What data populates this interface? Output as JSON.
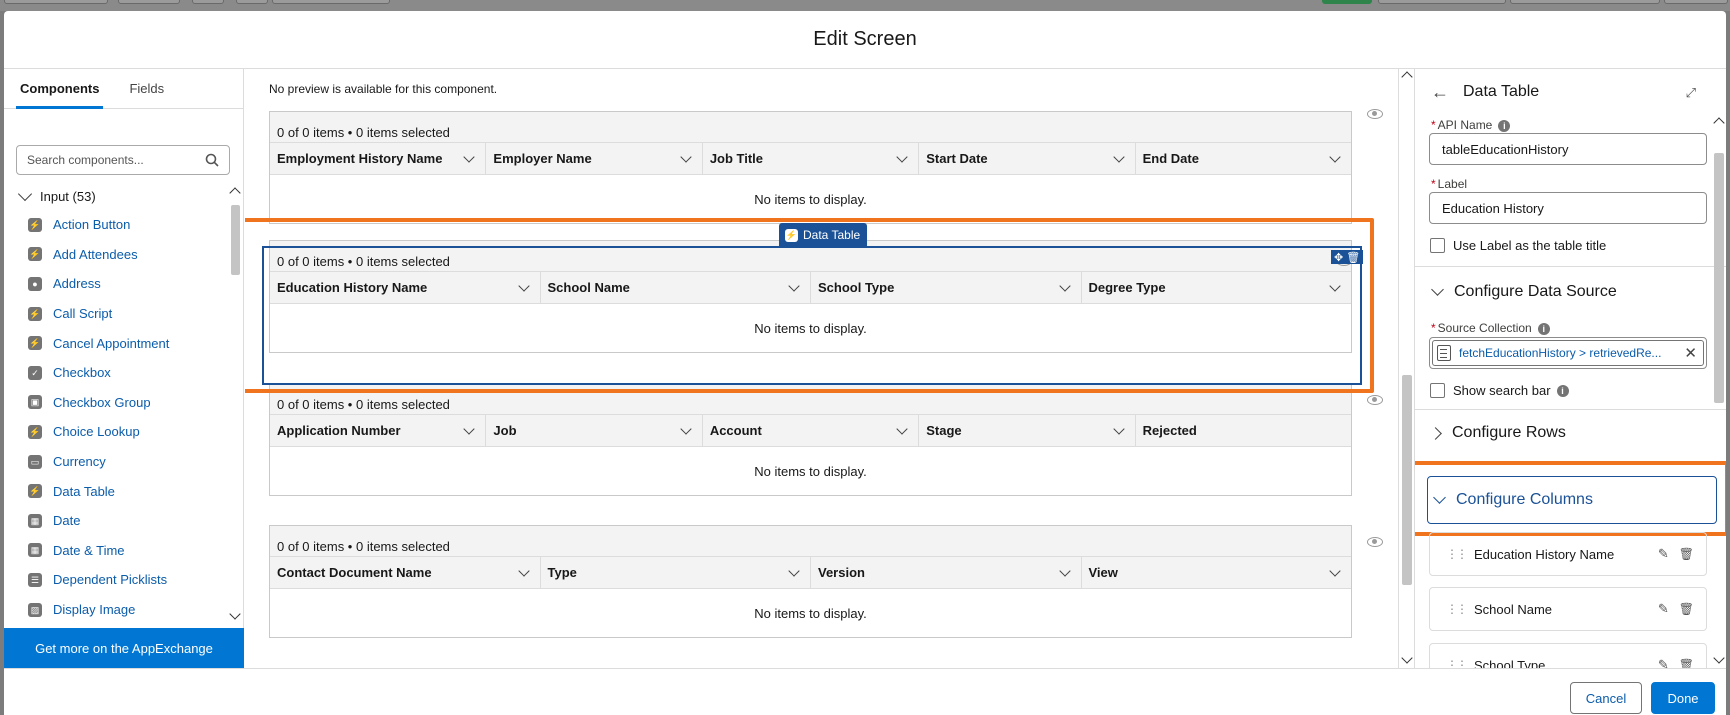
{
  "modal": {
    "title": "Edit Screen"
  },
  "left_panel": {
    "tabs": [
      {
        "label": "Components",
        "active": true
      },
      {
        "label": "Fields",
        "active": false
      }
    ],
    "search_placeholder": "Search components...",
    "group_label": "Input (53)",
    "components": [
      {
        "label": "Action Button",
        "icon": "lightning-icon"
      },
      {
        "label": "Add Attendees",
        "icon": "lightning-icon"
      },
      {
        "label": "Address",
        "icon": "location-icon"
      },
      {
        "label": "Call Script",
        "icon": "lightning-icon"
      },
      {
        "label": "Cancel Appointment",
        "icon": "lightning-icon"
      },
      {
        "label": "Checkbox",
        "icon": "checkbox-icon"
      },
      {
        "label": "Checkbox Group",
        "icon": "checkbox-group-icon"
      },
      {
        "label": "Choice Lookup",
        "icon": "lightning-icon"
      },
      {
        "label": "Currency",
        "icon": "currency-icon"
      },
      {
        "label": "Data Table",
        "icon": "lightning-icon"
      },
      {
        "label": "Date",
        "icon": "calendar-icon"
      },
      {
        "label": "Date & Time",
        "icon": "calendar-icon"
      },
      {
        "label": "Dependent Picklists",
        "icon": "list-icon"
      },
      {
        "label": "Display Image",
        "icon": "image-icon"
      }
    ],
    "appexchange_label": "Get more on the AppExchange"
  },
  "canvas": {
    "no_preview_text": "No preview is available for this component.",
    "selected_tag_label": "Data Table",
    "tables": [
      {
        "status": "0 of 0 items • 0 items selected",
        "columns": [
          "Employment History Name",
          "Employer Name",
          "Job Title",
          "Start Date",
          "End Date"
        ],
        "empty_text": "No items to display."
      },
      {
        "status": "0 of 0 items • 0 items selected",
        "columns": [
          "Education History Name",
          "School Name",
          "School Type",
          "Degree Type"
        ],
        "empty_text": "No items to display."
      },
      {
        "status": "0 of 0 items • 0 items selected",
        "columns": [
          "Application Number",
          "Job",
          "Account",
          "Stage",
          "Rejected"
        ],
        "empty_text": "No items to display."
      },
      {
        "status": "0 of 0 items • 0 items selected",
        "columns": [
          "Contact Document Name",
          "Type",
          "Version",
          "View"
        ],
        "empty_text": "No items to display."
      }
    ],
    "highlight_color": "#f0741e"
  },
  "properties": {
    "title": "Data Table",
    "api_name_label": "API Name",
    "api_name_value": "tableEducationHistory",
    "label_label": "Label",
    "label_value": "Education History",
    "use_label_as_title": "Use Label as the table title",
    "configure_data_source": "Configure Data Source",
    "source_collection_label": "Source Collection",
    "source_collection_value": "fetchEducationHistory > retrievedRe...",
    "show_search_bar": "Show search bar",
    "configure_rows": "Configure Rows",
    "configure_columns": "Configure Columns",
    "columns": [
      "Education History Name",
      "School Name",
      "School Type"
    ]
  },
  "footer": {
    "cancel_label": "Cancel",
    "done_label": "Done"
  },
  "colors": {
    "brand": "#0176d3",
    "selection": "#1b5297",
    "highlight": "#f0741e"
  }
}
